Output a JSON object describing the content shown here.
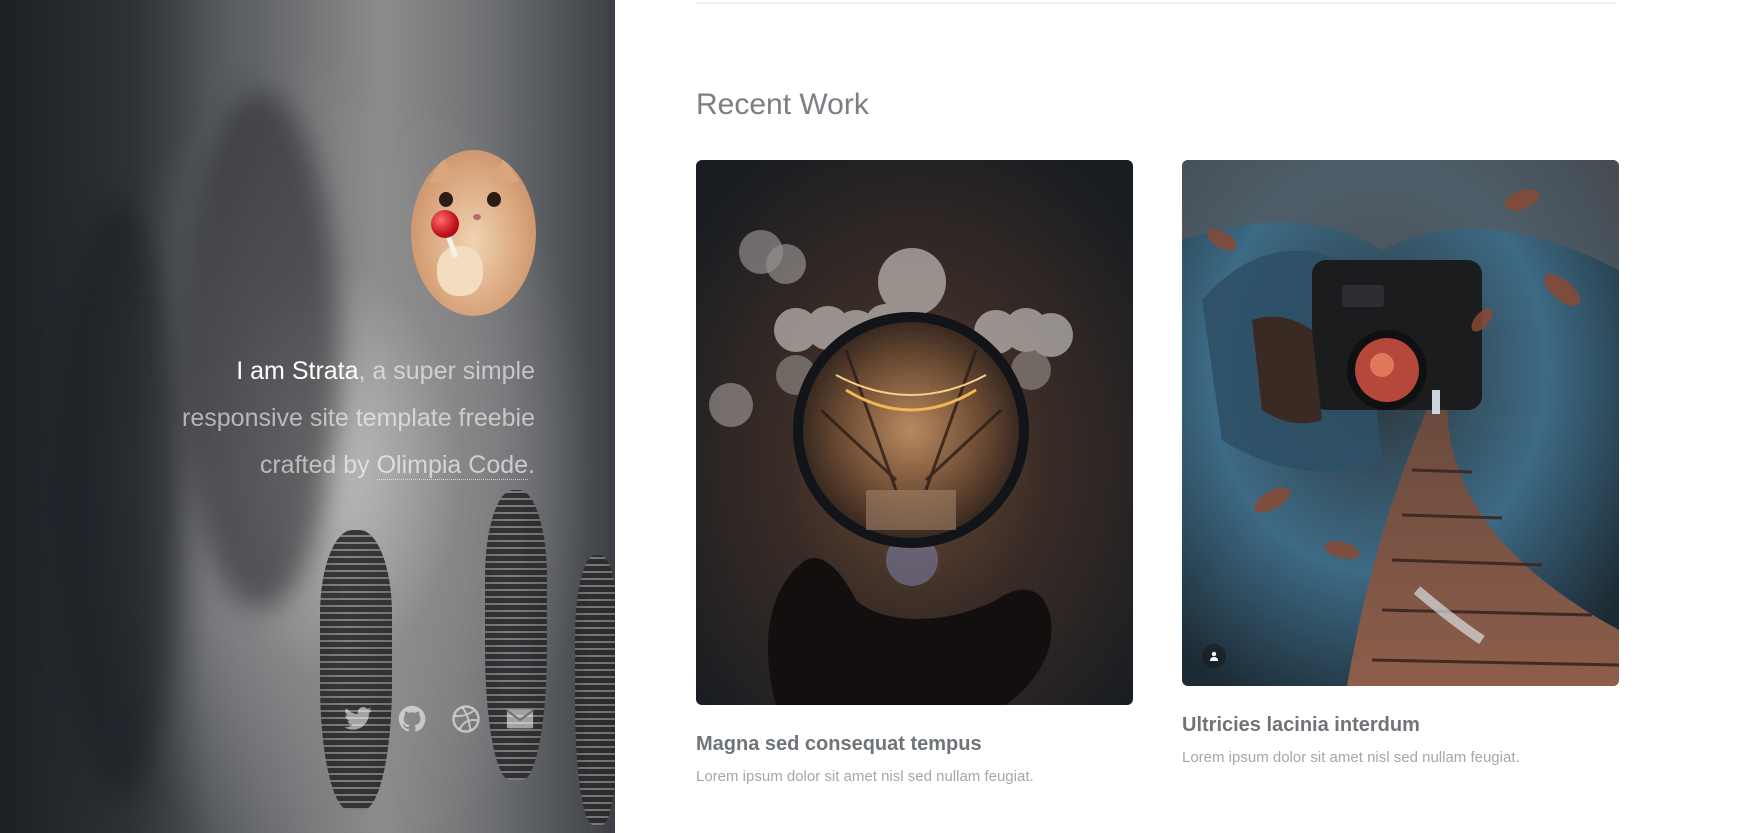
{
  "intro": {
    "name": "I am Strata",
    "text_1": ", a super simple responsive site template freebie crafted by ",
    "link": "Olimpia Code",
    "text_2": "."
  },
  "social": [
    {
      "icon": "twitter-icon"
    },
    {
      "icon": "github-icon"
    },
    {
      "icon": "dribbble-icon"
    },
    {
      "icon": "envelope-icon"
    }
  ],
  "recent_work": {
    "title": "Recent Work",
    "items": [
      {
        "title": "Magna sed consequat tempus",
        "description": "Lorem ipsum dolor sit amet nisl sed nullam feugiat."
      },
      {
        "title": "Ultricies lacinia interdum",
        "description": "Lorem ipsum dolor sit amet nisl sed nullam feugiat."
      }
    ]
  },
  "colors": {
    "sidebar_dark": "#2c3136",
    "heading": "#7b7f83",
    "body_text": "#a3a7ab"
  }
}
